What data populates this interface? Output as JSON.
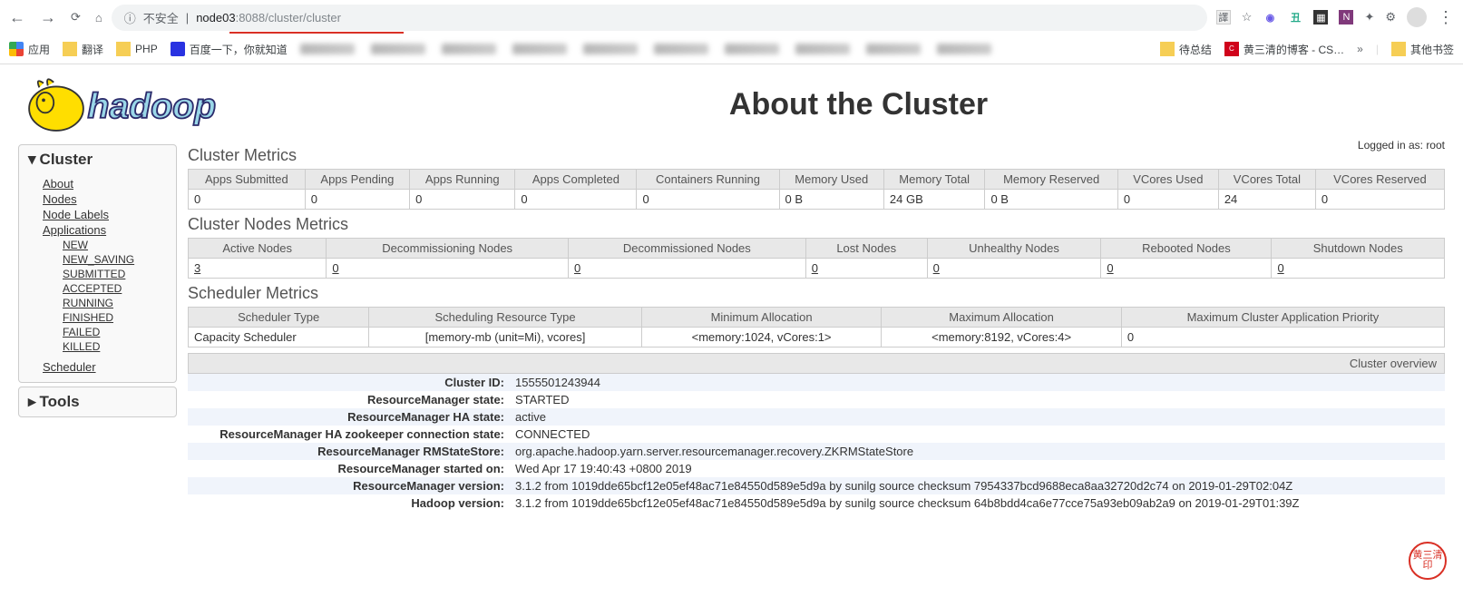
{
  "browser": {
    "security_label": "不安全",
    "url_host": "node03",
    "url_port": ":8088",
    "url_path": "/cluster/cluster"
  },
  "bookmarks": {
    "apps": "应用",
    "translate": "翻译",
    "php": "PHP",
    "baidu": "百度一下，你就知道",
    "pending": "待总结",
    "blog": "黄三清的博客 - CS…",
    "other": "其他书签"
  },
  "logged_in": "Logged in as: root",
  "page_title": "About the Cluster",
  "sidebar": {
    "cluster": "Cluster",
    "about": "About",
    "nodes": "Nodes",
    "node_labels": "Node Labels",
    "applications": "Applications",
    "app_states": [
      "NEW",
      "NEW_SAVING",
      "SUBMITTED",
      "ACCEPTED",
      "RUNNING",
      "FINISHED",
      "FAILED",
      "KILLED"
    ],
    "scheduler": "Scheduler",
    "tools": "Tools"
  },
  "sections": {
    "cluster_metrics": "Cluster Metrics",
    "cluster_nodes": "Cluster Nodes Metrics",
    "scheduler": "Scheduler Metrics",
    "overview": "Cluster overview"
  },
  "cluster_metrics": {
    "headers": [
      "Apps Submitted",
      "Apps Pending",
      "Apps Running",
      "Apps Completed",
      "Containers Running",
      "Memory Used",
      "Memory Total",
      "Memory Reserved",
      "VCores Used",
      "VCores Total",
      "VCores Reserved"
    ],
    "values": [
      "0",
      "0",
      "0",
      "0",
      "0",
      "0 B",
      "24 GB",
      "0 B",
      "0",
      "24",
      "0"
    ]
  },
  "nodes_metrics": {
    "headers": [
      "Active Nodes",
      "Decommissioning Nodes",
      "Decommissioned Nodes",
      "Lost Nodes",
      "Unhealthy Nodes",
      "Rebooted Nodes",
      "Shutdown Nodes"
    ],
    "values": [
      "3",
      "0",
      "0",
      "0",
      "0",
      "0",
      "0"
    ]
  },
  "scheduler_metrics": {
    "headers": [
      "Scheduler Type",
      "Scheduling Resource Type",
      "Minimum Allocation",
      "Maximum Allocation",
      "Maximum Cluster Application Priority"
    ],
    "values": [
      "Capacity Scheduler",
      "[memory-mb (unit=Mi), vcores]",
      "<memory:1024, vCores:1>",
      "<memory:8192, vCores:4>",
      "0"
    ]
  },
  "overview": [
    {
      "k": "Cluster ID:",
      "v": "1555501243944"
    },
    {
      "k": "ResourceManager state:",
      "v": "STARTED"
    },
    {
      "k": "ResourceManager HA state:",
      "v": "active"
    },
    {
      "k": "ResourceManager HA zookeeper connection state:",
      "v": "CONNECTED"
    },
    {
      "k": "ResourceManager RMStateStore:",
      "v": "org.apache.hadoop.yarn.server.resourcemanager.recovery.ZKRMStateStore"
    },
    {
      "k": "ResourceManager started on:",
      "v": "Wed Apr 17 19:40:43 +0800 2019"
    },
    {
      "k": "ResourceManager version:",
      "v": "3.1.2 from 1019dde65bcf12e05ef48ac71e84550d589e5d9a by sunilg source checksum 7954337bcd9688eca8aa32720d2c74 on 2019-01-29T02:04Z"
    },
    {
      "k": "Hadoop version:",
      "v": "3.1.2 from 1019dde65bcf12e05ef48ac71e84550d589e5d9a by sunilg source checksum 64b8bdd4ca6e77cce75a93eb09ab2a9 on 2019-01-29T01:39Z"
    }
  ],
  "watermark": "黄三清印"
}
